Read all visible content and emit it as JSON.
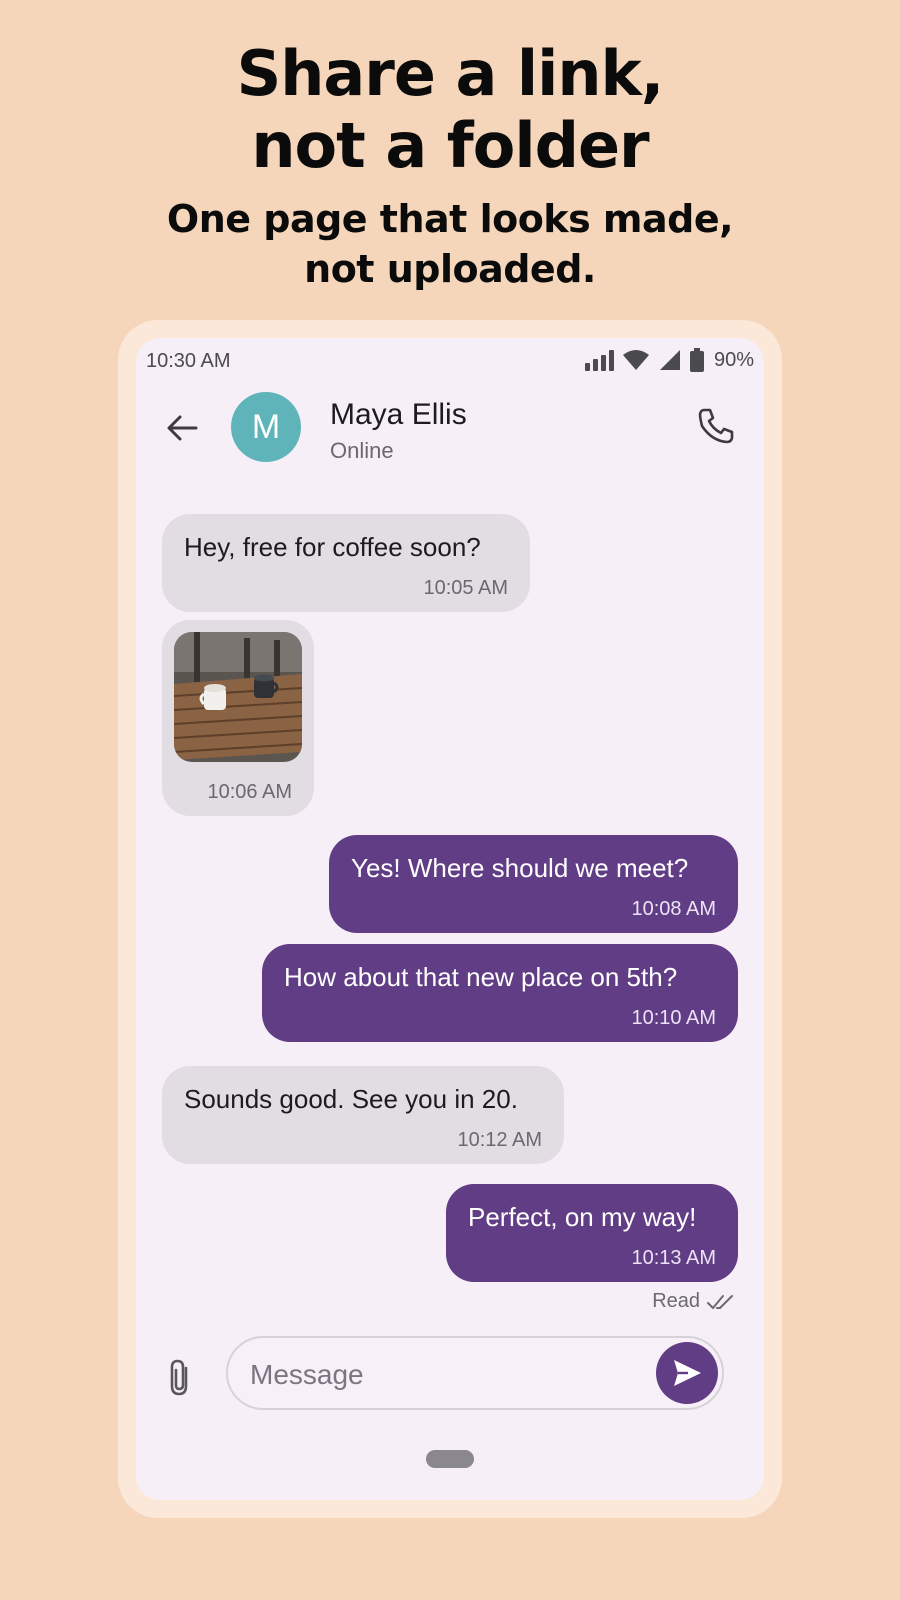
{
  "promo": {
    "headline_line1": "Share a link,",
    "headline_line2": "not a folder",
    "subhead_line1": "One page that looks made,",
    "subhead_line2": "not uploaded."
  },
  "status_bar": {
    "time": "10:30 AM",
    "battery": "90%",
    "icons": [
      "signal-bars-icon",
      "wifi-icon",
      "cell-signal-icon",
      "battery-icon"
    ]
  },
  "header": {
    "avatar_initial": "M",
    "contact_name": "Maya Ellis",
    "contact_status": "Online",
    "icons": [
      "back-arrow-icon",
      "phone-icon"
    ]
  },
  "messages": [
    {
      "direction": "incoming",
      "text": "Hey, free for coffee soon?",
      "time": "10:05 AM"
    },
    {
      "direction": "incoming",
      "type": "image",
      "image": "coffee-cups-on-wooden-table",
      "time": "10:06 AM"
    },
    {
      "direction": "outgoing",
      "text": "Yes! Where should we meet?",
      "time": "10:08 AM"
    },
    {
      "direction": "outgoing",
      "text": "How about that new place on 5th?",
      "time": "10:10 AM"
    },
    {
      "direction": "incoming",
      "text": "Sounds good. See you in 20.",
      "time": "10:12 AM"
    },
    {
      "direction": "outgoing",
      "text": "Perfect, on my way!",
      "time": "10:13 AM"
    }
  ],
  "read_receipt": "Read",
  "composer": {
    "placeholder": "Message",
    "icons": [
      "paperclip-icon",
      "send-icon"
    ]
  },
  "colors": {
    "background": "#f5d6bb",
    "outgoing_bubble": "#613d85",
    "incoming_bubble": "#e2dde3",
    "avatar": "#5fb4ba"
  }
}
